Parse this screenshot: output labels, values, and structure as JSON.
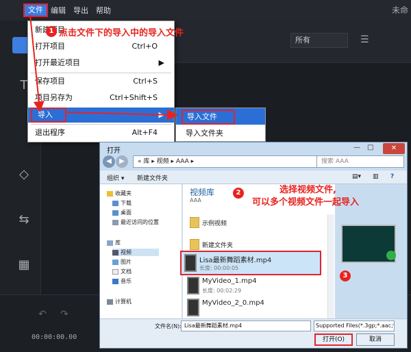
{
  "menubar": {
    "items": [
      "文件",
      "编辑",
      "导出",
      "帮助"
    ],
    "title": "未命"
  },
  "filter": {
    "selected": "所有"
  },
  "timeline": {
    "timecode": "00:00:00.00"
  },
  "file_menu": {
    "items": [
      {
        "label": "新建项目",
        "shortcut": ""
      },
      {
        "label": "打开项目",
        "shortcut": "Ctrl+O"
      },
      {
        "label": "打开最近项目",
        "shortcut": "▶"
      },
      {
        "label": "保存项目",
        "shortcut": "Ctrl+S"
      },
      {
        "label": "项目另存为",
        "shortcut": "Ctrl+Shift+S"
      },
      {
        "label": "导入",
        "shortcut": "▶"
      },
      {
        "label": "退出程序",
        "shortcut": "Alt+F4"
      }
    ]
  },
  "submenu": {
    "items": [
      "导入文件",
      "导入文件夹"
    ]
  },
  "annotations": {
    "step1": "点击文件下的导入中的导入文件",
    "step2_line1": "选择视频文件,",
    "step2_line2": "可以多个视频文件一起导入",
    "badge1": "1",
    "badge2": "2",
    "badge3": "3"
  },
  "dialog": {
    "title": "打开",
    "close": "✕",
    "address": "« 库 ▸ 视频 ▸ AAA ▸",
    "search_placeholder": "搜索 AAA",
    "toolbar": [
      "组织 ▾",
      "新建文件夹"
    ],
    "nav": {
      "favorites": "收藏夹",
      "downloads": "下载",
      "desktop": "桌面",
      "recent": "最近访问的位置",
      "libraries": "库",
      "videos": "视频",
      "pictures": "图片",
      "documents": "文档",
      "music": "音乐",
      "computer": "计算机"
    },
    "library_title": "视频库",
    "library_sub": "AAA",
    "folders": [
      "示例视频",
      "新建文件夹"
    ],
    "files": [
      {
        "name": "Lisa最新舞蹈素材.mp4",
        "duration": "长度: 00:00:05"
      },
      {
        "name": "MyVideo_1.mp4",
        "duration": "长度: 00:02:29"
      },
      {
        "name": "MyVideo_2_0.mp4",
        "duration": ""
      }
    ],
    "filename_label": "文件名(N):",
    "filename_value": "Lisa最新舞蹈素材.mp4",
    "filetype": "Supported Files(*.3gp;*.aac;*",
    "open_label": "打开(O)",
    "cancel_label": "取消"
  }
}
